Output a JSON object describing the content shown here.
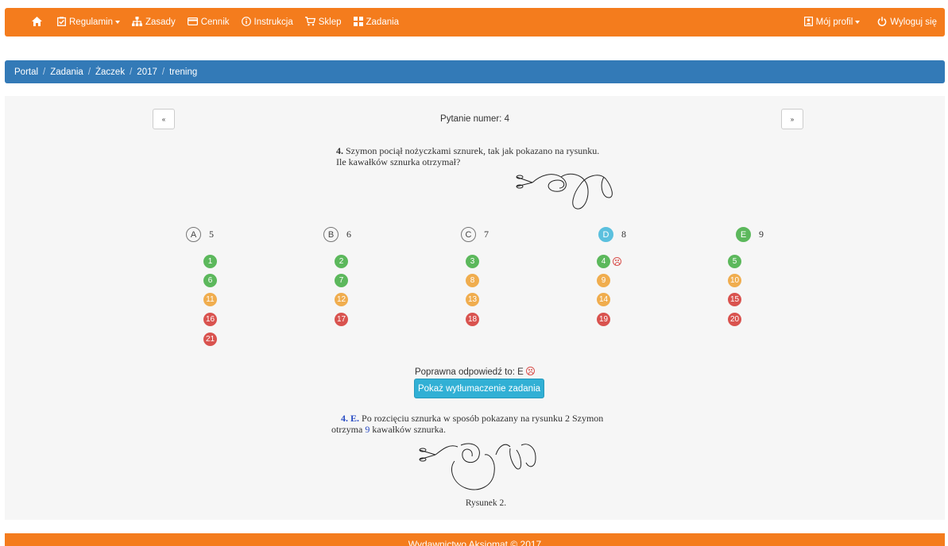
{
  "nav": {
    "home_icon": "home-icon",
    "items": [
      {
        "label": "Regulamin",
        "icon": "clipboard-check-icon",
        "dropdown": true
      },
      {
        "label": "Zasady",
        "icon": "sitemap-icon",
        "dropdown": false
      },
      {
        "label": "Cennik",
        "icon": "credit-card-icon",
        "dropdown": false
      },
      {
        "label": "Instrukcja",
        "icon": "info-circle-icon",
        "dropdown": false
      },
      {
        "label": "Sklep",
        "icon": "cart-icon",
        "dropdown": false
      },
      {
        "label": "Zadania",
        "icon": "grid-icon",
        "dropdown": false
      }
    ],
    "profile_label": "Mój profil",
    "logout_label": "Wyloguj się"
  },
  "breadcrumb": [
    "Portal",
    "Zadania",
    "Żaczek",
    "2017",
    "trening"
  ],
  "question": {
    "prev_label": "«",
    "next_label": "»",
    "number_label": "Pytanie numer: 4",
    "num": "4.",
    "text_line1": "Szymon pociął nożyczkami sznurek, tak jak pokazano na rysunku.",
    "text_line2": "Ile kawałków sznurka otrzymał?"
  },
  "answers": [
    {
      "letter": "A",
      "value": "5",
      "state": "none"
    },
    {
      "letter": "B",
      "value": "6",
      "state": "none"
    },
    {
      "letter": "C",
      "value": "7",
      "state": "none"
    },
    {
      "letter": "D",
      "value": "8",
      "state": "selected"
    },
    {
      "letter": "E",
      "value": "9",
      "state": "correct"
    }
  ],
  "question_grid": [
    {
      "n": "1",
      "status": "green"
    },
    {
      "n": "2",
      "status": "green"
    },
    {
      "n": "3",
      "status": "green"
    },
    {
      "n": "4",
      "status": "green",
      "current": true
    },
    {
      "n": "5",
      "status": "green"
    },
    {
      "n": "6",
      "status": "green"
    },
    {
      "n": "7",
      "status": "green"
    },
    {
      "n": "8",
      "status": "orange"
    },
    {
      "n": "9",
      "status": "orange"
    },
    {
      "n": "10",
      "status": "orange"
    },
    {
      "n": "11",
      "status": "orange"
    },
    {
      "n": "12",
      "status": "orange"
    },
    {
      "n": "13",
      "status": "orange"
    },
    {
      "n": "14",
      "status": "orange"
    },
    {
      "n": "15",
      "status": "red"
    },
    {
      "n": "16",
      "status": "red"
    },
    {
      "n": "17",
      "status": "red"
    },
    {
      "n": "18",
      "status": "red"
    },
    {
      "n": "19",
      "status": "red"
    },
    {
      "n": "20",
      "status": "red"
    },
    {
      "n": "21",
      "status": "red"
    }
  ],
  "result": {
    "correct_label": "Poprawna odpowiedź to: E",
    "explain_button": "Pokaż wytłumaczenie zadania"
  },
  "explanation": {
    "num": "4.",
    "letter": "E.",
    "text_a": "Po rozcięciu sznurka w sposób pokazany na rysunku 2 Szymon",
    "text_b": "otrzyma",
    "count": "9",
    "text_c": "kawałków sznurka.",
    "caption": "Rysunek 2."
  },
  "footer": "Wydawnictwo Aksjomat © 2017",
  "colors": {
    "nav": "#f47c1d",
    "breadcrumb": "#337ab7",
    "green": "#5cb85c",
    "orange": "#f0ad4e",
    "red": "#d9534f",
    "info": "#5bc0de"
  }
}
